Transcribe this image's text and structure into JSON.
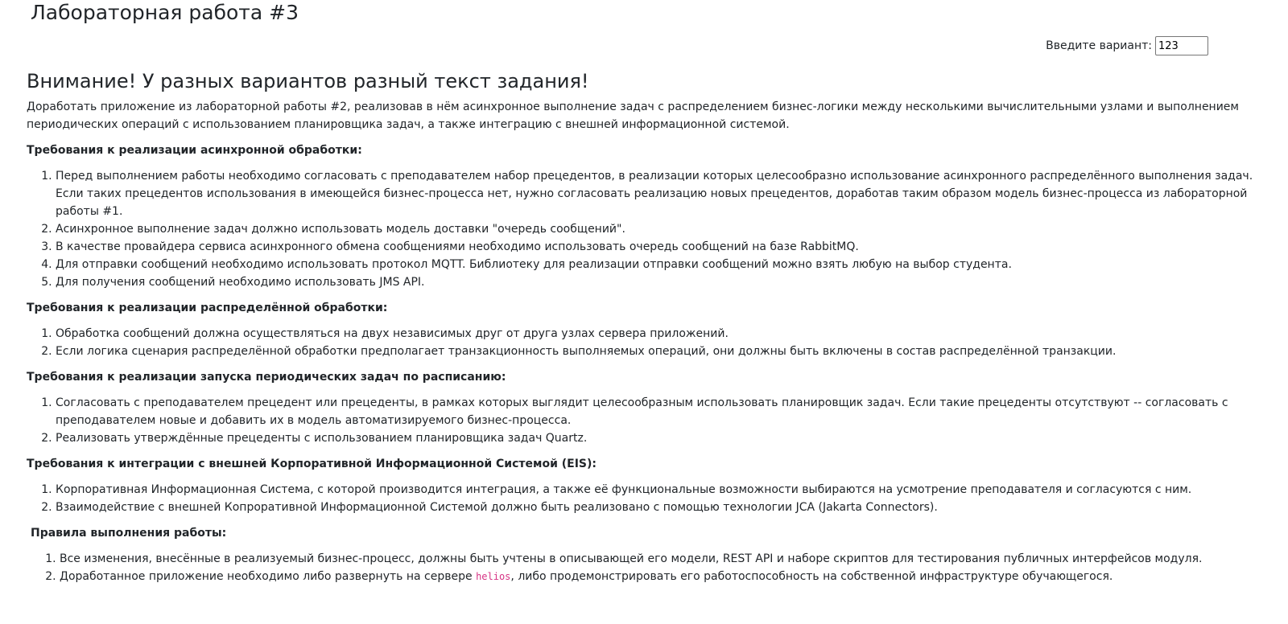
{
  "page": {
    "title": "Лабораторная работа #3"
  },
  "variant": {
    "label": "Введите вариант:",
    "value": "123"
  },
  "warning": "Внимание! У разных вариантов разный текст задания!",
  "intro": "Доработать приложение из лабораторной работы #2, реализовав в нём асинхронное выполнение задач с распределением бизнес-логики между несколькими вычислительными узлами и выполнением периодических операций с использованием планировщика задач, а также интеграцию с внешней информационной системой.",
  "sections": [
    {
      "heading": "Требования к реализации асинхронной обработки:",
      "items": [
        "Перед выполнением работы необходимо согласовать с преподавателем набор прецедентов, в реализации которых целесообразно использование асинхронного распределённого выполнения задач. Если таких прецедентов использования в имеющейся бизнес-процесса нет, нужно согласовать реализацию новых прецедентов, доработав таким образом модель бизнес-процесса из лабораторной работы #1.",
        "Асинхронное выполнение задач должно использовать модель доставки \"очередь сообщений\".",
        "В качестве провайдера сервиса асинхронного обмена сообщениями необходимо использовать очередь сообщений на базе RabbitMQ.",
        "Для отправки сообщений необходимо использовать протокол MQTT. Библиотеку для реализации отправки сообщений можно взять любую на выбор студента.",
        "Для получения сообщений необходимо использовать JMS API."
      ]
    },
    {
      "heading": "Требования к реализации распределённой обработки:",
      "items": [
        "Обработка сообщений должна осуществляться на двух независимых друг от друга узлах сервера приложений.",
        "Если логика сценария распределённой обработки предполагает транзакционность выполняемых операций, они должны быть включены в состав распределённой транзакции."
      ]
    },
    {
      "heading": "Требования к реализации запуска периодических задач по расписанию:",
      "items": [
        "Согласовать с преподавателем прецедент или прецеденты, в рамках которых выглядит целесообразным использовать планировщик задач. Если такие прецеденты отсутствуют -- согласовать с преподавателем новые и добавить их в модель автоматизируемого бизнес-процесса.",
        "Реализовать утверждённые прецеденты с использованием планировщика задач Quartz."
      ]
    },
    {
      "heading": "Требования к интеграции с внешней Корпоративной Информационной Системой (EIS):",
      "items": [
        "Корпоративная Информационная Система, с которой производится интеграция, а также её функциональные возможности выбираются на усмотрение преподавателя и согласуются с ним.",
        "Взаимодействие с внешней Копроративной Информационной Системой должно быть реализовано с помощью технологии JCA (Jakarta Connectors)."
      ]
    }
  ],
  "rules": {
    "heading": "Правила выполнения работы:",
    "item1": "Все изменения, внесённые в реализуемый бизнес-процесс, должны быть учтены в описывающей его модели, REST API и наборе скриптов для тестирования публичных интерфейсов модуля.",
    "item2_before": "Доработанное приложение необходимо либо развернуть на сервере ",
    "item2_code": "helios",
    "item2_after": ", либо продемонстрировать его работоспособность на собственной инфраструктуре обучающегося."
  }
}
